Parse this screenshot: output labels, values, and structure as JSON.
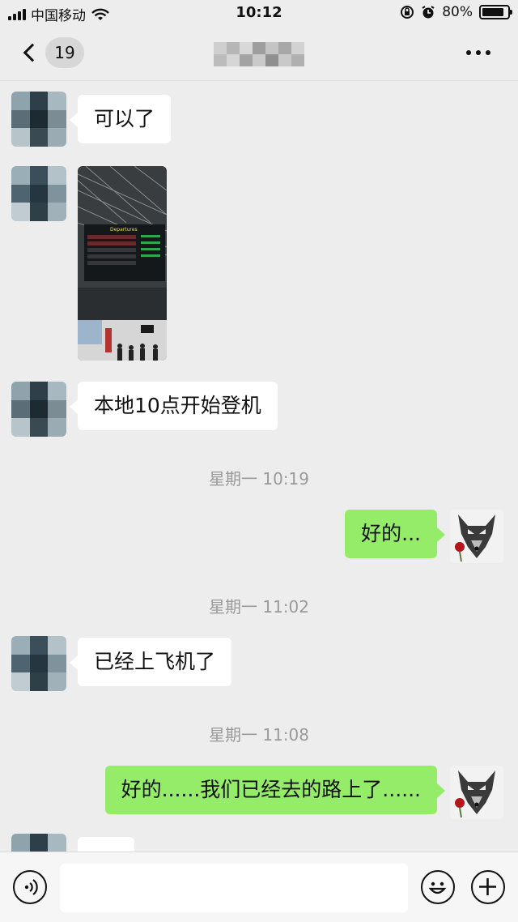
{
  "status_bar": {
    "carrier": "中国移动",
    "time": "10:12",
    "battery": "80%",
    "icons": [
      "signal-icon",
      "wifi-icon",
      "orientation-lock-icon",
      "alarm-icon",
      "battery-icon"
    ]
  },
  "header": {
    "unread_count": "19",
    "icons": [
      "chevron-left-icon",
      "more-icon"
    ]
  },
  "messages": [
    {
      "type": "text",
      "direction": "incoming",
      "text": "可以了"
    },
    {
      "type": "image",
      "direction": "incoming",
      "caption": "Departures"
    },
    {
      "type": "text",
      "direction": "incoming",
      "text": "本地10点开始登机"
    },
    {
      "type": "timestamp",
      "text": "星期一 10:19"
    },
    {
      "type": "text",
      "direction": "outgoing",
      "text": "好的..."
    },
    {
      "type": "timestamp",
      "text": "星期一 11:02"
    },
    {
      "type": "text",
      "direction": "incoming",
      "text": "已经上飞机了"
    },
    {
      "type": "timestamp",
      "text": "星期一 11:08"
    },
    {
      "type": "text",
      "direction": "outgoing",
      "text": "好的......我们已经去的路上了......"
    }
  ],
  "input_bar": {
    "icons": [
      "voice-icon",
      "emoji-icon",
      "plus-icon"
    ]
  },
  "colors": {
    "background": "#ededed",
    "incoming_bubble": "#ffffff",
    "outgoing_bubble": "#95ec69"
  }
}
